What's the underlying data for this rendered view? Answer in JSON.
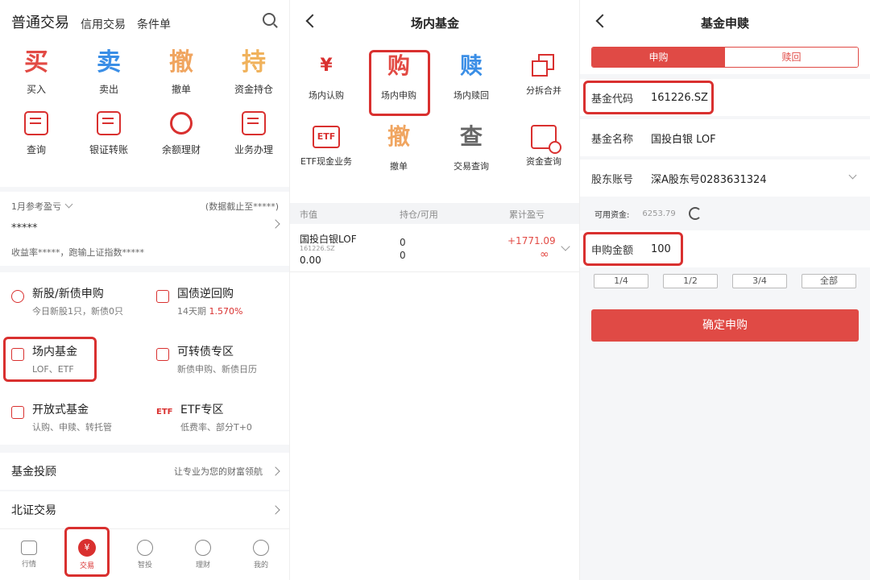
{
  "p1": {
    "title": "普通交易",
    "tab1": "信用交易",
    "tab2": "条件单",
    "grid": [
      {
        "glyph": "买",
        "label": "买入",
        "color": "#e24a44"
      },
      {
        "glyph": "卖",
        "label": "卖出",
        "color": "#3a8ee6"
      },
      {
        "glyph": "撤",
        "label": "撤单",
        "color": "#f0a560"
      },
      {
        "glyph": "持",
        "label": "资金持仓",
        "color": "#f0b25c"
      },
      {
        "label": "查询"
      },
      {
        "label": "银证转账"
      },
      {
        "label": "余额理财"
      },
      {
        "label": "业务办理"
      }
    ],
    "profit": {
      "label": "1月参考盈亏",
      "note": "(数据截止至*****)",
      "value": "*****",
      "sub": "收益率*****，跑输上证指数*****"
    },
    "menu": [
      {
        "title": "新股/新债申购",
        "sub": "今日新股1只，新债0只"
      },
      {
        "title": "国债逆回购",
        "sub": "14天期",
        "rate": "1.570%"
      },
      {
        "title": "场内基金",
        "sub": "LOF、ETF"
      },
      {
        "title": "可转债专区",
        "sub": "新债申购、新债日历"
      },
      {
        "title": "开放式基金",
        "sub": "认购、申赎、转托管"
      },
      {
        "title": "ETF专区",
        "sub": "低费率、部分T+0",
        "icon": "ETF"
      }
    ],
    "row1": {
      "title": "基金投顾",
      "sub": "让专业为您的财富领航"
    },
    "row2": {
      "title": "北证交易"
    },
    "nav": [
      {
        "label": "行情"
      },
      {
        "label": "交易",
        "glyph": "¥"
      },
      {
        "label": "智投"
      },
      {
        "label": "理财"
      },
      {
        "label": "我的"
      }
    ]
  },
  "p2": {
    "title": "场内基金",
    "grid": [
      {
        "label": "场内认购",
        "glyph": "¥"
      },
      {
        "label": "场内申购",
        "glyph": "购",
        "color": "#e24a44"
      },
      {
        "label": "场内赎回",
        "glyph": "赎",
        "color": "#3a8ee6"
      },
      {
        "label": "分拆合并"
      },
      {
        "label": "ETF现金业务",
        "glyph": "ETF"
      },
      {
        "label": "撤单",
        "glyph": "撤",
        "color": "#f0a560"
      },
      {
        "label": "交易查询",
        "glyph": "查",
        "color": "#666"
      },
      {
        "label": "资金查询"
      }
    ],
    "table": {
      "h1": "市值",
      "h2": "持仓/可用",
      "h3": "累计盈亏",
      "row": {
        "name": "国投白银LOF",
        "code": "161226.SZ",
        "mv": "0.00",
        "hold": "0",
        "avail": "0",
        "pl": "+1771.09",
        "pl2": "∞"
      }
    }
  },
  "p3": {
    "title": "基金申赎",
    "seg_on": "申购",
    "seg_off": "赎回",
    "code_label": "基金代码",
    "code": "161226.SZ",
    "name_label": "基金名称",
    "name": "国投白银 LOF",
    "acct_label": "股东账号",
    "acct": "深A股东号0283631324",
    "avail_label": "可用资金:",
    "avail": "6253.79",
    "amt_label": "申购金额",
    "amt": "100",
    "fracs": [
      "1/4",
      "1/2",
      "3/4",
      "全部"
    ],
    "confirm": "确定申购"
  }
}
